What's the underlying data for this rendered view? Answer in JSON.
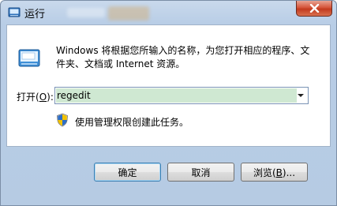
{
  "window": {
    "title": "运行",
    "close_icon": "close-icon"
  },
  "dialog": {
    "description": "Windows 将根据您所输入的名称，为您打开相应的程序、文件夹、文档或 Internet 资源。",
    "open_label_prefix": "打开(",
    "open_label_accel": "O",
    "open_label_suffix": "):",
    "command_value": "regedit",
    "admin_note": "使用管理权限创建此任务。"
  },
  "buttons": {
    "ok": "确定",
    "cancel": "取消",
    "browse_prefix": "浏览(",
    "browse_accel": "B",
    "browse_suffix": ")..."
  },
  "colors": {
    "input_highlight": "#cfe8d2",
    "close_button": "#d5553b",
    "frame": "#b8cde6"
  }
}
